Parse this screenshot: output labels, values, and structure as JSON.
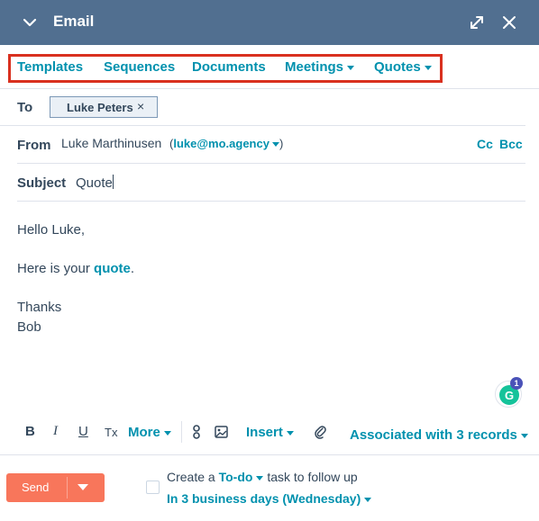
{
  "header": {
    "title": "Email"
  },
  "toolbar": {
    "items": [
      {
        "label": "Templates",
        "has_dropdown": false
      },
      {
        "label": "Sequences",
        "has_dropdown": false
      },
      {
        "label": "Documents",
        "has_dropdown": false
      },
      {
        "label": "Meetings",
        "has_dropdown": true
      },
      {
        "label": "Quotes",
        "has_dropdown": true
      }
    ],
    "highlight_color": "#d9301f"
  },
  "fields": {
    "to_label": "To",
    "to_recipient": "Luke Peters",
    "from_label": "From",
    "from_name": "Luke Marthinusen",
    "from_email_open": "(",
    "from_email": "luke@mo.agency",
    "from_email_close": ")",
    "cc_label": "Cc",
    "bcc_label": "Bcc",
    "subject_label": "Subject",
    "subject_value": "Quote"
  },
  "message": {
    "greeting": "Hello Luke,",
    "line2_prefix": "Here is your ",
    "line2_link": "quote",
    "line2_suffix": ".",
    "closing": "Thanks",
    "signature": "Bob"
  },
  "grammarly": {
    "count": "1"
  },
  "format_bar": {
    "bold": "B",
    "italic": "I",
    "underline": "U",
    "clear": "Tx",
    "more_label": "More",
    "insert_label": "Insert",
    "associated_label": "Associated with 3 records"
  },
  "footer": {
    "send_label": "Send",
    "todo_prefix": "Create a ",
    "todo_link": "To-do",
    "todo_suffix": " task to follow up",
    "due_label": "In 3 business days (Wednesday)"
  },
  "colors": {
    "header_bg": "#516f90",
    "link": "#0091ae",
    "send_bg": "#f8765b",
    "text": "#33475b"
  }
}
